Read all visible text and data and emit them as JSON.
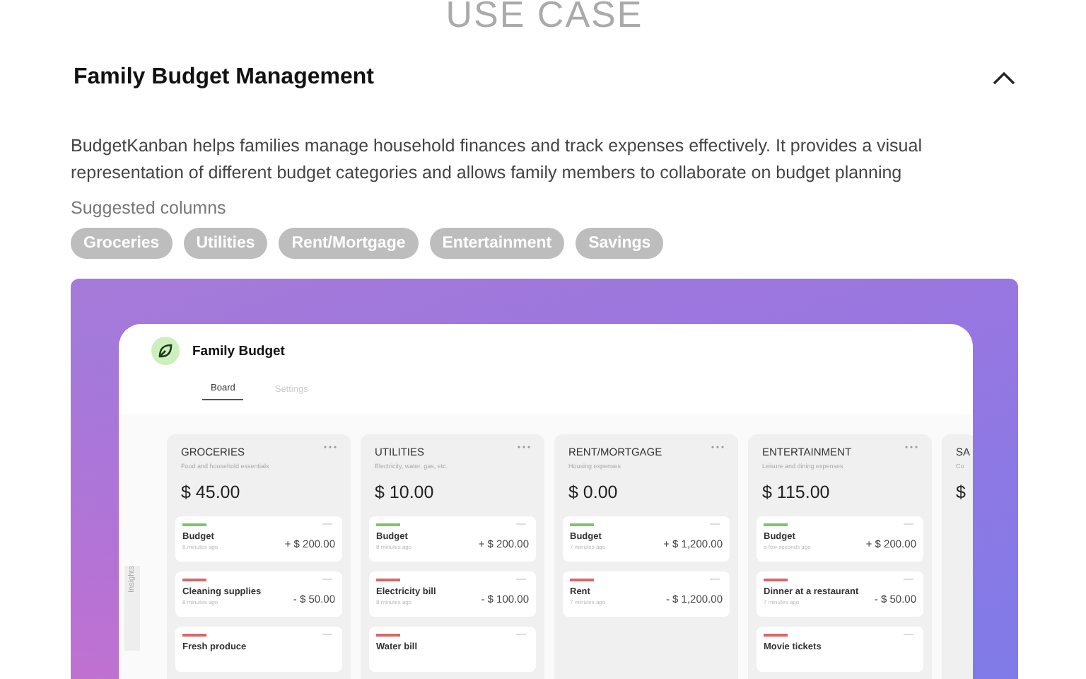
{
  "section_title": "USE CASE",
  "use_case": {
    "title": "Family Budget Management",
    "expanded": true,
    "description": "BudgetKanban helps families manage household finances and track expenses effectively. It provides a visual representation of different budget categories and allows family members to collaborate on budget planning",
    "suggested_label": "Suggested columns",
    "chips": [
      "Groceries",
      "Utilities",
      "Rent/Mortgage",
      "Entertainment",
      "Savings"
    ]
  },
  "app_preview": {
    "title": "Family Budget",
    "tabs": [
      {
        "label": "Board",
        "selected": true
      },
      {
        "label": "Settings",
        "selected": false
      }
    ],
    "side_tab": "Insights",
    "columns": [
      {
        "title": "GROCERIES",
        "subtitle": "Food and household essentials",
        "total": "$ 45.00",
        "cards": [
          {
            "kind": "income",
            "title": "Budget",
            "time": "8 minutes ago",
            "amount": "+ $ 200.00"
          },
          {
            "kind": "expense",
            "title": "Cleaning supplies",
            "time": "8 minutes ago",
            "amount": "- $ 50.00"
          },
          {
            "kind": "expense",
            "title": "Fresh produce"
          }
        ]
      },
      {
        "title": "UTILITIES",
        "subtitle": "Electricity, water, gas, etc.",
        "total": "$ 10.00",
        "cards": [
          {
            "kind": "income",
            "title": "Budget",
            "time": "8 minutes ago",
            "amount": "+ $ 200.00"
          },
          {
            "kind": "expense",
            "title": "Electricity bill",
            "time": "8 minutes ago",
            "amount": "- $ 100.00"
          },
          {
            "kind": "expense",
            "title": "Water bill"
          }
        ]
      },
      {
        "title": "RENT/MORTGAGE",
        "subtitle": "Housing expenses",
        "total": "$ 0.00",
        "cards": [
          {
            "kind": "income",
            "title": "Budget",
            "time": "7 minutes ago",
            "amount": "+ $ 1,200.00"
          },
          {
            "kind": "expense",
            "title": "Rent",
            "time": "7 minutes ago",
            "amount": "- $ 1,200.00"
          }
        ]
      },
      {
        "title": "ENTERTAINMENT",
        "subtitle": "Leisure and dining expenses",
        "total": "$ 115.00",
        "cards": [
          {
            "kind": "income",
            "title": "Budget",
            "time": "a few seconds ago",
            "amount": "+ $ 200.00"
          },
          {
            "kind": "expense",
            "title": "Dinner at a restaurant",
            "time": "7 minutes ago",
            "amount": "- $ 50.00"
          },
          {
            "kind": "expense",
            "title": "Movie tickets"
          }
        ]
      },
      {
        "title": "SA",
        "subtitle": "Co",
        "total": "$"
      }
    ]
  }
}
